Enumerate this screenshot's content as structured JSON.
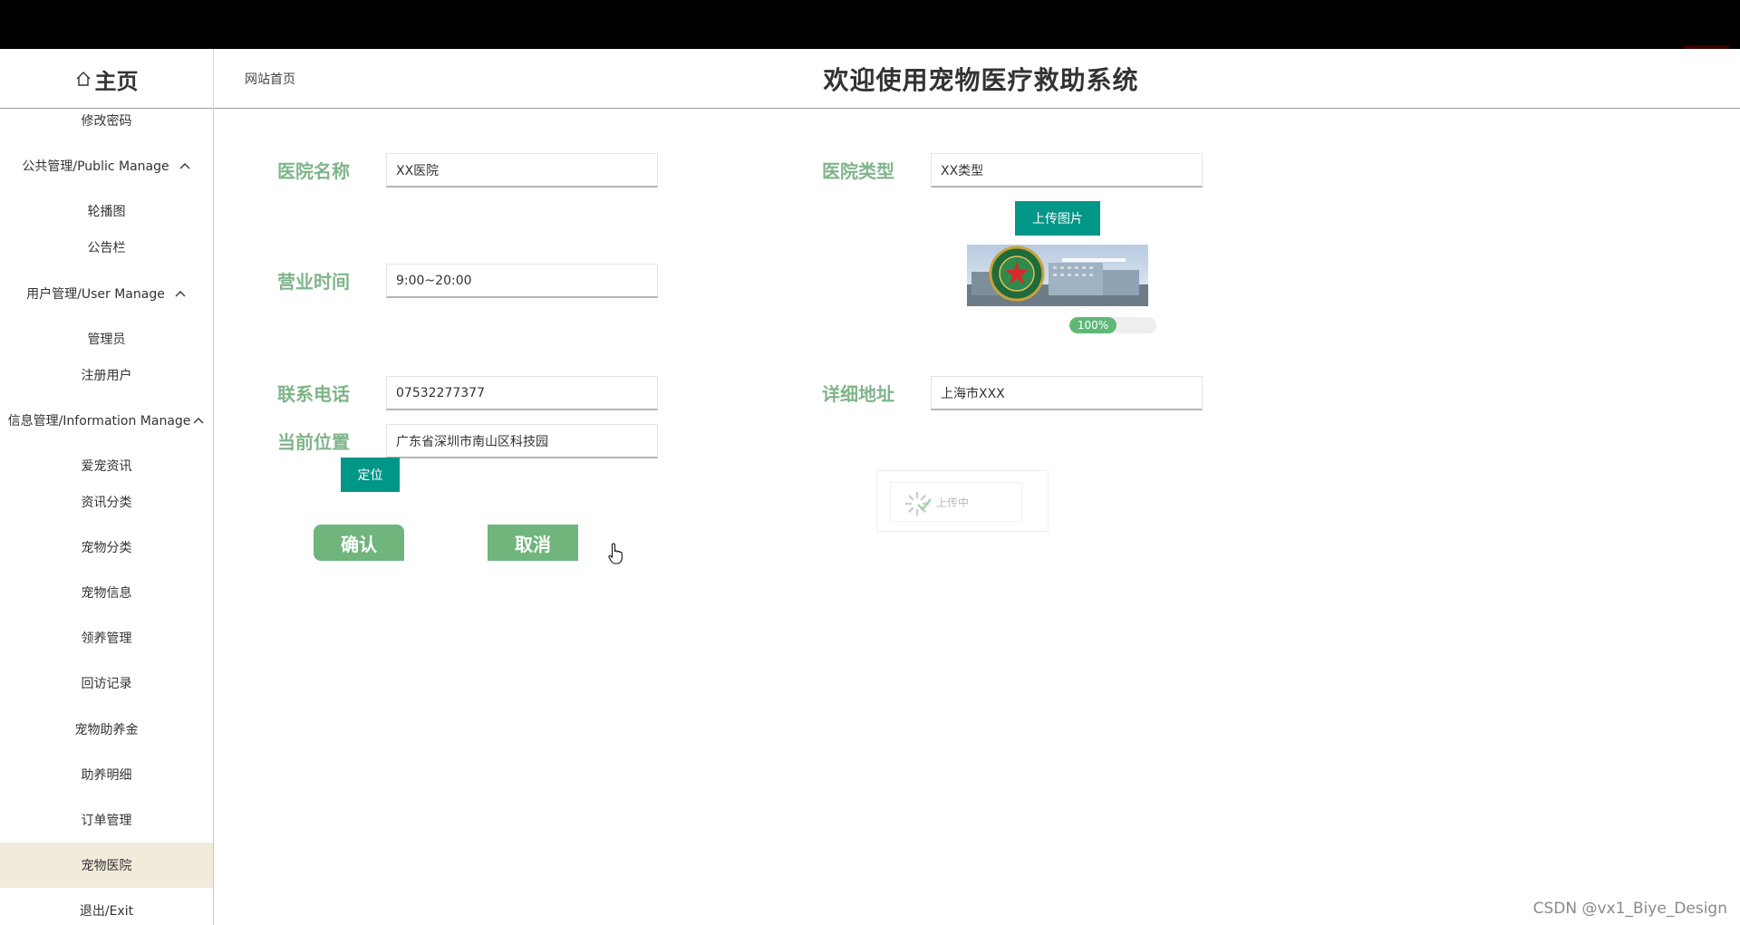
{
  "header": {
    "home_label": "主页",
    "breadcrumb": "网站首页",
    "title": "欢迎使用宠物医疗救助系统"
  },
  "sidebar": {
    "items": [
      {
        "label": "修改密码",
        "type": "item"
      },
      {
        "label": "公共管理/Public Manage",
        "type": "group"
      },
      {
        "label": "轮播图",
        "type": "item"
      },
      {
        "label": "公告栏",
        "type": "item"
      },
      {
        "label": "用户管理/User Manage",
        "type": "group"
      },
      {
        "label": "管理员",
        "type": "item"
      },
      {
        "label": "注册用户",
        "type": "item"
      },
      {
        "label": "信息管理/Information Manage",
        "type": "group"
      },
      {
        "label": "爱宠资讯",
        "type": "item"
      },
      {
        "label": "资讯分类",
        "type": "item"
      },
      {
        "label": "宠物分类",
        "type": "item"
      },
      {
        "label": "宠物信息",
        "type": "item"
      },
      {
        "label": "领养管理",
        "type": "item"
      },
      {
        "label": "回访记录",
        "type": "item"
      },
      {
        "label": "宠物助养金",
        "type": "item"
      },
      {
        "label": "助养明细",
        "type": "item"
      },
      {
        "label": "订单管理",
        "type": "item"
      },
      {
        "label": "宠物医院",
        "type": "item",
        "active": true
      },
      {
        "label": "退出/Exit",
        "type": "item"
      }
    ]
  },
  "form": {
    "hospital_name": {
      "label": "医院名称",
      "value": "XX医院"
    },
    "hospital_type": {
      "label": "医院类型",
      "value": "XX类型"
    },
    "business_hours": {
      "label": "营业时间",
      "value": "9:00~20:00"
    },
    "phone": {
      "label": "联系电话",
      "value": "07532277377"
    },
    "address": {
      "label": "详细地址",
      "value": "上海市XXX"
    },
    "location": {
      "label": "当前位置",
      "value": "广东省深圳市南山区科技园"
    },
    "locate_button": "定位",
    "upload_button": "上传图片",
    "upload_progress": {
      "percent": 100,
      "text": "100%"
    },
    "loading_text": "上传中",
    "confirm_button": "确认",
    "cancel_button": "取消"
  },
  "watermark": "CSDN @vx1_Biye_Design",
  "colors": {
    "label_green": "#7fb58a",
    "teal": "#009688",
    "button_green": "#6fb57c",
    "active_menu_bg": "#f2ebdc",
    "progress_fill": "#5fb878"
  }
}
